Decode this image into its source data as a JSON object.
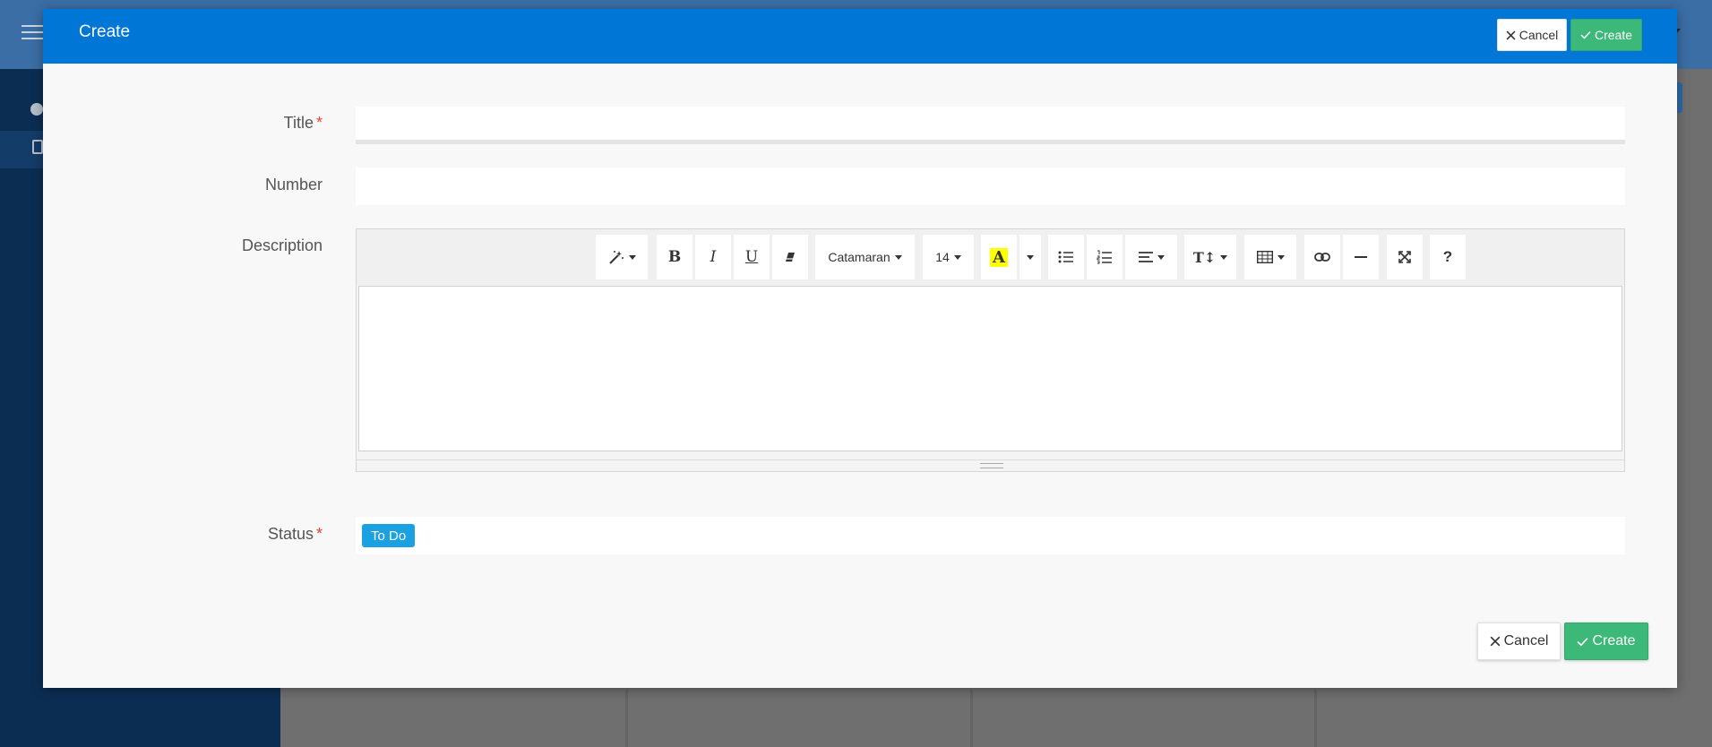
{
  "modal": {
    "title": "Create",
    "header_cancel_label": "Cancel",
    "header_create_label": "Create",
    "footer_cancel_label": "Cancel",
    "footer_create_label": "Create"
  },
  "form": {
    "title_label": "Title",
    "title_value": "",
    "number_label": "Number",
    "number_value": "",
    "description_label": "Description",
    "status_label": "Status",
    "required_mark": "*",
    "status_value": "To Do"
  },
  "editor_toolbar": {
    "font_family": "Catamaran",
    "font_size": "14",
    "highlight_letter": "A",
    "help_label": "?"
  },
  "icons": {
    "cancel": "close-icon",
    "create": "check-icon"
  },
  "colors": {
    "header": "#0076d6",
    "create_button": "#3cb878",
    "status_badge": "#1ba0e2",
    "required": "#e2453c",
    "highlight": "#ffff00"
  }
}
